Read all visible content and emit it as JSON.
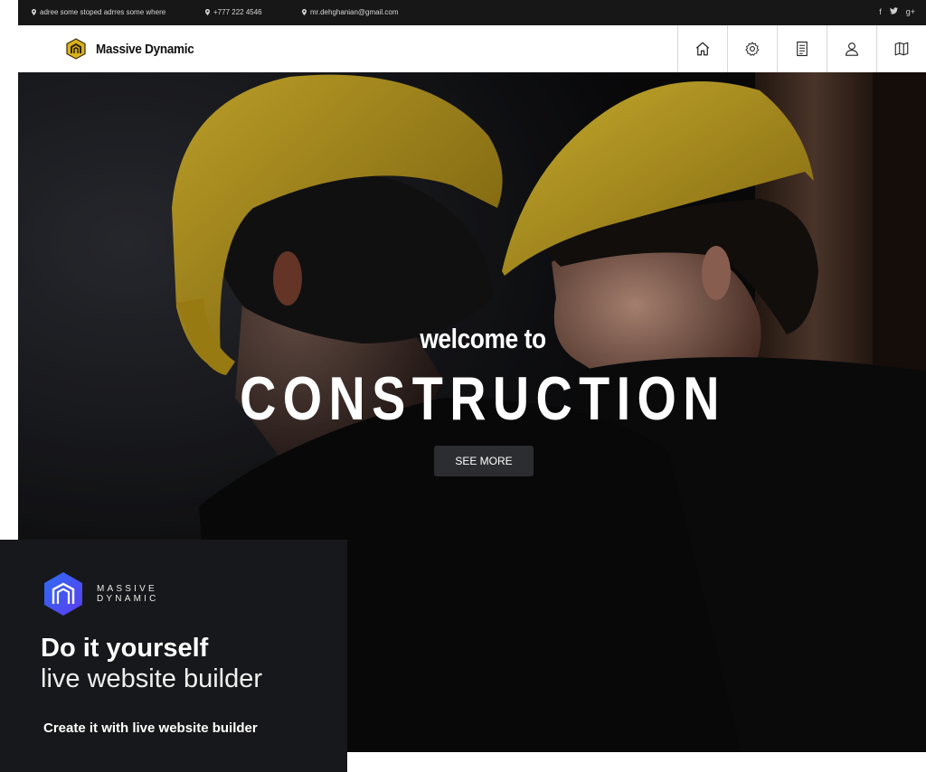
{
  "topbar": {
    "address": "adree some stoped adrres some where",
    "phone": "+777 222 4546",
    "email": "mr.dehghanian@gmail.com",
    "social": [
      "f",
      "t",
      "g+"
    ]
  },
  "header": {
    "brand": "Massive Dynamic",
    "nav_icons": [
      "home-icon",
      "gear-icon",
      "document-icon",
      "user-icon",
      "map-icon"
    ]
  },
  "hero": {
    "subtitle": "welcome to",
    "title": "CONSTRUCTION",
    "button": "SEE MORE"
  },
  "promo": {
    "logo_line1": "MASSIVE",
    "logo_line2": "DYNAMIC",
    "heading_bold": "Do it yourself",
    "heading_light": "live website builder",
    "cta": "Create it with live website builder"
  },
  "colors": {
    "helmet": "#d9b21c",
    "dark_bar": "#171717",
    "promo_bg": "#17181b",
    "logo_gradient_start": "#5b3df0",
    "logo_gradient_end": "#2f6cf2"
  }
}
